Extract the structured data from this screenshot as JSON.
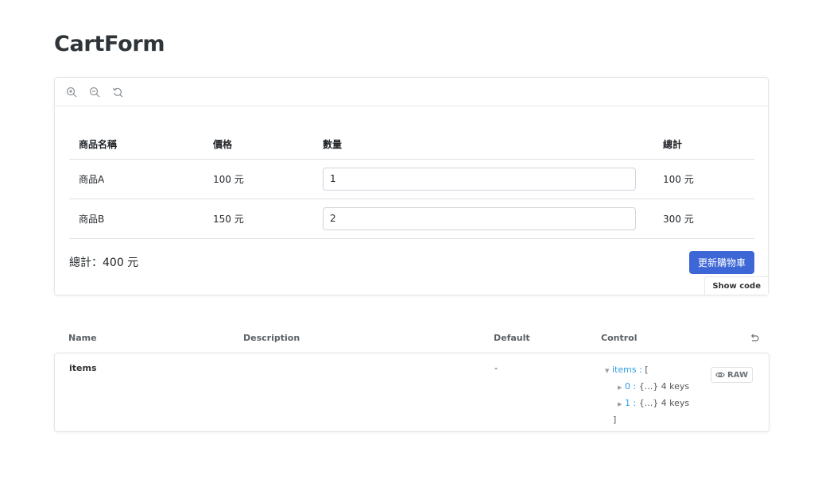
{
  "page": {
    "title": "CartForm"
  },
  "toolbar": {
    "zoom_in": "zoom-in-icon",
    "zoom_out": "zoom-out-icon",
    "reset": "reset-zoom-icon"
  },
  "cart": {
    "headers": [
      "商品名稱",
      "價格",
      "數量",
      "總計"
    ],
    "rows": [
      {
        "name": "商品A",
        "price": "100 元",
        "qty": "1",
        "total": "100 元"
      },
      {
        "name": "商品B",
        "price": "150 元",
        "qty": "2",
        "total": "300 元"
      }
    ],
    "grand_total": "總計：400 元",
    "update_button": "更新購物車",
    "button_color": "#3d66d6"
  },
  "preview": {
    "show_code": "Show code"
  },
  "args_table": {
    "headers": {
      "name": "Name",
      "description": "Description",
      "default": "Default",
      "control": "Control"
    },
    "row": {
      "name": "items",
      "description": "",
      "default": "-",
      "control": {
        "key": "items",
        "sep": " : ",
        "open": "[",
        "entries": [
          {
            "index": "0",
            "value": "{...} 4 keys"
          },
          {
            "index": "1",
            "value": "{...} 4 keys"
          }
        ],
        "close": "]",
        "raw_label": "RAW"
      }
    }
  }
}
